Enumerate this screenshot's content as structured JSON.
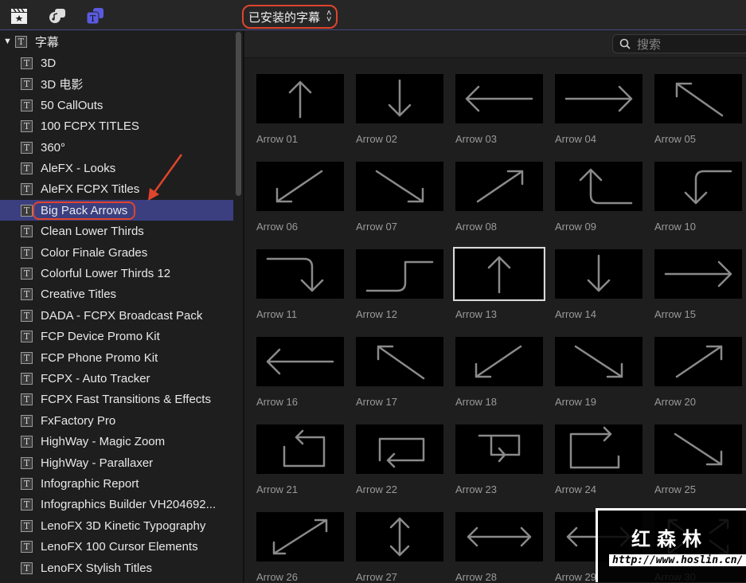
{
  "toolbar": {
    "dropdown_label": "已安装的字幕",
    "icons": [
      "clapper-star-icon",
      "music-photo-icon",
      "titles-icon"
    ]
  },
  "sidebar": {
    "root": "字幕",
    "items": [
      "3D",
      "3D 电影",
      "50 CallOuts",
      "100 FCPX TITLES",
      "360°",
      "AleFX - Looks",
      "AleFX FCPX Titles",
      "Big Pack Arrows",
      "Clean Lower Thirds",
      "Color Finale Grades",
      "Colorful Lower Thirds 12",
      "Creative Titles",
      "DADA - FCPX Broadcast Pack",
      "FCP Device Promo Kit",
      "FCP Phone Promo Kit",
      "FCPX - Auto Tracker",
      "FCPX Fast Transitions & Effects",
      "FxFactory Pro",
      "HighWay - Magic Zoom",
      "HighWay - Parallaxer",
      "Infographic Report",
      "Infographics Builder VH204692...",
      "LenoFX 3D Kinetic Typography",
      "LenoFX 100 Cursor Elements",
      "LenoFX Stylish Titles"
    ],
    "selected_index": 7
  },
  "search": {
    "placeholder": "搜索"
  },
  "grid": {
    "selected_index": 12,
    "items": [
      {
        "label": "Arrow 01",
        "glyph": "up"
      },
      {
        "label": "Arrow 02",
        "glyph": "down"
      },
      {
        "label": "Arrow 03",
        "glyph": "left"
      },
      {
        "label": "Arrow 04",
        "glyph": "right"
      },
      {
        "label": "Arrow 05",
        "glyph": "upleft"
      },
      {
        "label": "Arrow 06",
        "glyph": "downleft"
      },
      {
        "label": "Arrow 07",
        "glyph": "downright"
      },
      {
        "label": "Arrow 08",
        "glyph": "upright"
      },
      {
        "label": "Arrow 09",
        "glyph": "bendup"
      },
      {
        "label": "Arrow 10",
        "glyph": "benddown"
      },
      {
        "label": "Arrow 11",
        "glyph": "benddown2"
      },
      {
        "label": "Arrow 12",
        "glyph": "bendup2"
      },
      {
        "label": "Arrow 13",
        "glyph": "up"
      },
      {
        "label": "Arrow 14",
        "glyph": "down"
      },
      {
        "label": "Arrow 15",
        "glyph": "right"
      },
      {
        "label": "Arrow 16",
        "glyph": "left"
      },
      {
        "label": "Arrow 17",
        "glyph": "upleft"
      },
      {
        "label": "Arrow 18",
        "glyph": "downleft"
      },
      {
        "label": "Arrow 19",
        "glyph": "downright"
      },
      {
        "label": "Arrow 20",
        "glyph": "upright"
      },
      {
        "label": "Arrow 21",
        "glyph": "loop1"
      },
      {
        "label": "Arrow 22",
        "glyph": "loop2"
      },
      {
        "label": "Arrow 23",
        "glyph": "loop3"
      },
      {
        "label": "Arrow 24",
        "glyph": "loop4"
      },
      {
        "label": "Arrow 25",
        "glyph": "downright"
      },
      {
        "label": "Arrow 26",
        "glyph": "diag2"
      },
      {
        "label": "Arrow 27",
        "glyph": "vert2"
      },
      {
        "label": "Arrow 28",
        "glyph": "horiz2"
      },
      {
        "label": "Arrow 29",
        "glyph": "horiz2"
      },
      {
        "label": "Arrow 30",
        "glyph": "expand"
      }
    ]
  },
  "watermark": {
    "title": "红森林",
    "url": "http://www.hoslin.cn/"
  }
}
